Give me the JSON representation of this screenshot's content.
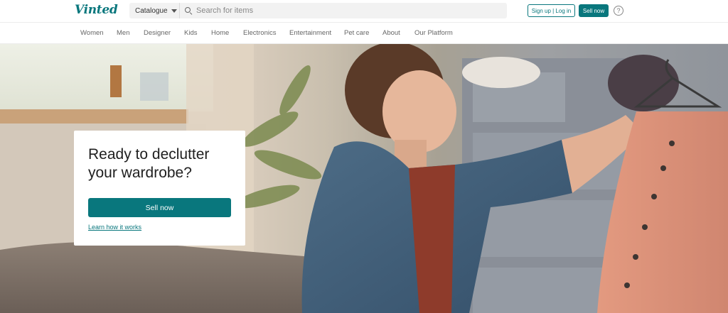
{
  "header": {
    "logo_text": "Vinted",
    "catalogue_label": "Catalogue",
    "search_placeholder": "Search for items",
    "signup_label": "Sign up | Log in",
    "sell_now_label": "Sell now",
    "help_symbol": "?"
  },
  "categories": [
    "Women",
    "Men",
    "Designer",
    "Kids",
    "Home",
    "Electronics",
    "Entertainment",
    "Pet care",
    "About",
    "Our Platform"
  ],
  "hero": {
    "title": "Ready to declutter your wardrobe?",
    "sell_button_label": "Sell now",
    "learn_link_label": "Learn how it works"
  },
  "colors": {
    "brand": "#09777d",
    "search_bg": "#f2f2f2"
  }
}
